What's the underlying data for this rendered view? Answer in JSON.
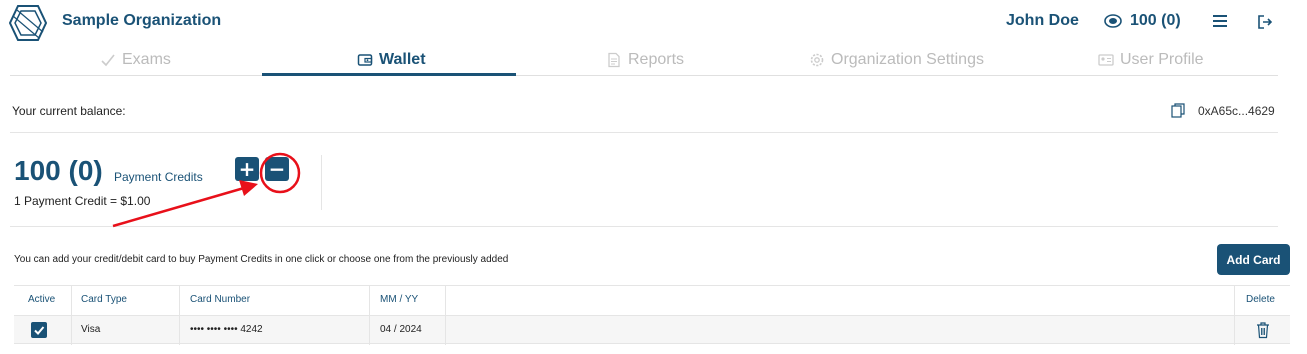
{
  "header": {
    "org_name": "Sample Organization",
    "user_name": "John Doe",
    "credits": "100 (0)"
  },
  "tabs": [
    {
      "label": "Exams",
      "icon": "check-icon",
      "active": false
    },
    {
      "label": "Wallet",
      "icon": "wallet-icon",
      "active": true
    },
    {
      "label": "Reports",
      "icon": "document-icon",
      "active": false
    },
    {
      "label": "Organization Settings",
      "icon": "gear-icon",
      "active": false
    },
    {
      "label": "User Profile",
      "icon": "id-card-icon",
      "active": false
    }
  ],
  "balance": {
    "label": "Your current balance:",
    "wallet_address": "0xA65c...4629",
    "value": "100 (0)",
    "unit": "Payment Credits",
    "rate": "1 Payment Credit = $1.00",
    "add_symbol": "+",
    "subtract_symbol": "−"
  },
  "cards": {
    "note": "You can add your credit/debit card to buy Payment Credits in one click or choose one from the previously added",
    "add_label": "Add Card",
    "headers": {
      "active": "Active",
      "type": "Card Type",
      "number": "Card Number",
      "expiry": "MM / YY",
      "delete": "Delete"
    },
    "rows": [
      {
        "active": true,
        "type": "Visa",
        "number": "•••• •••• •••• 4242",
        "expiry": "04 / 2024"
      }
    ]
  },
  "colors": {
    "brand": "#1a5276",
    "annotation": "#e8101a"
  }
}
